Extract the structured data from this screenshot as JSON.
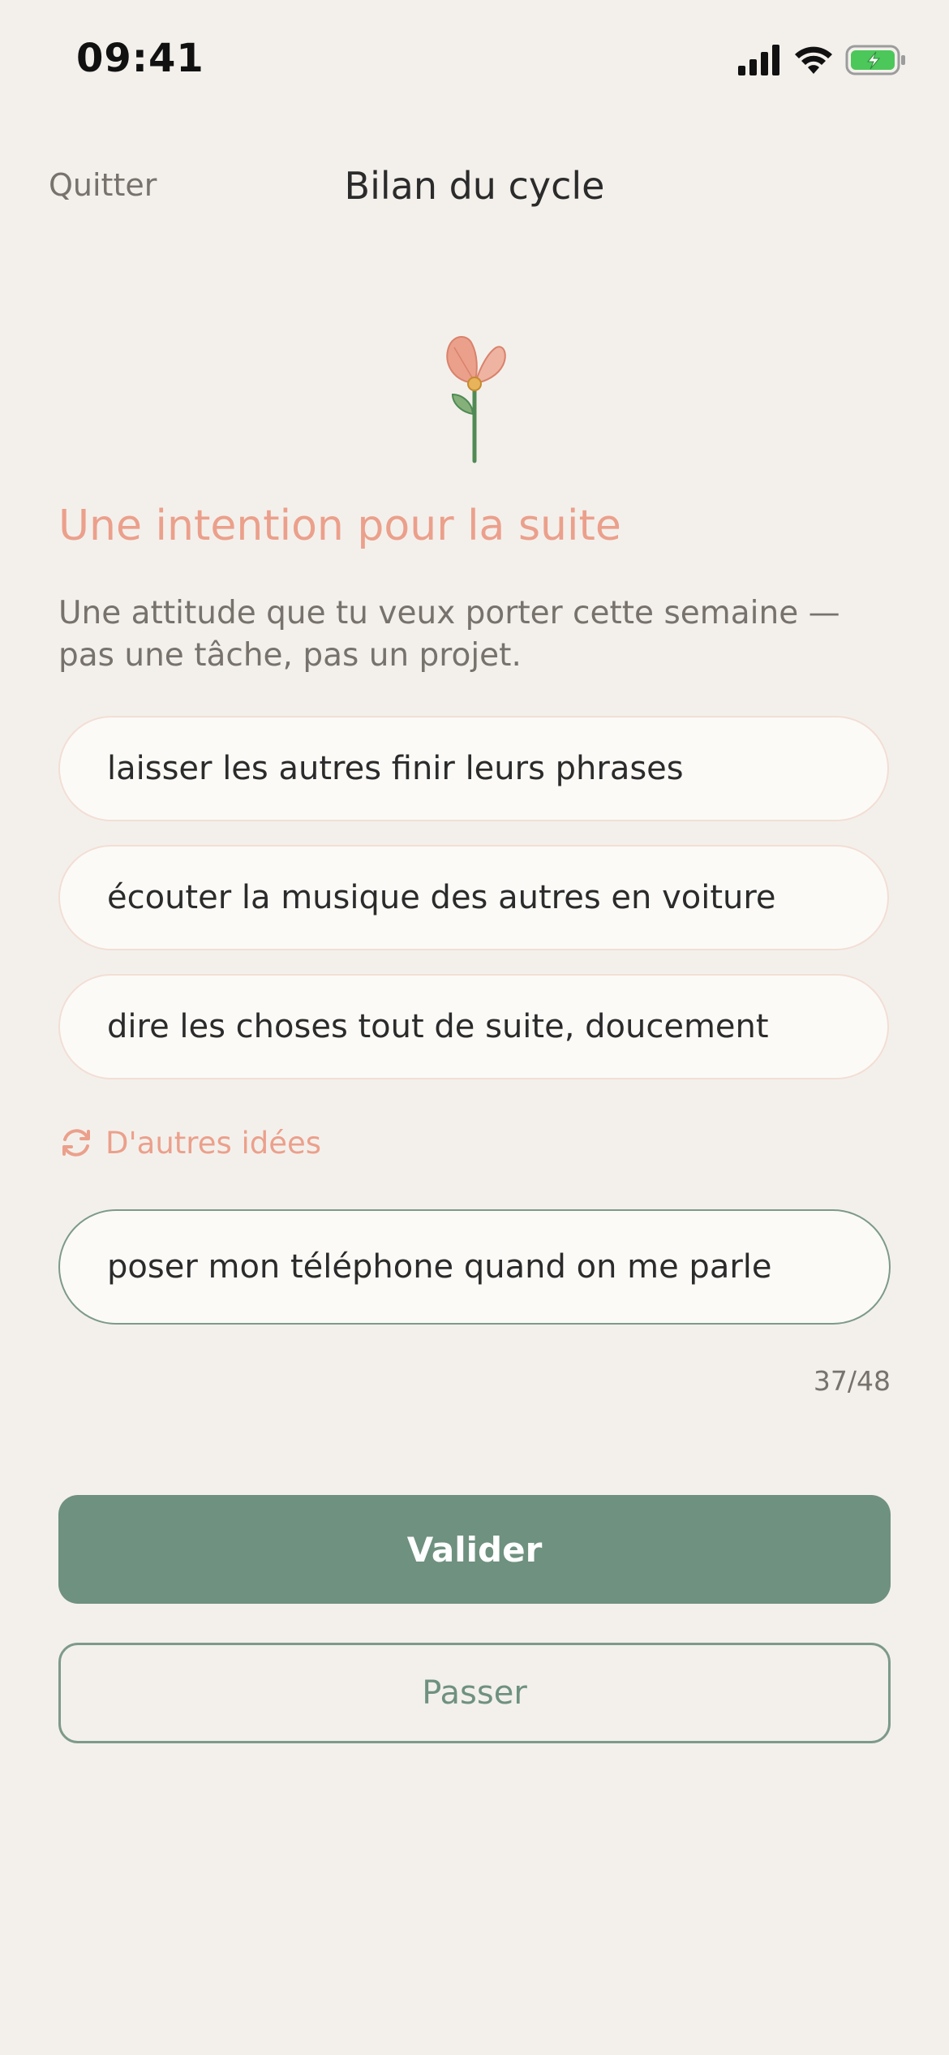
{
  "status_bar": {
    "time": "09:41"
  },
  "nav": {
    "quit_label": "Quitter",
    "title": "Bilan du cycle"
  },
  "content": {
    "heading": "Une intention pour la suite",
    "subheading": "Une attitude que tu veux porter cette semaine — pas une tâche, pas un projet.",
    "suggestions": [
      "laisser les autres finir leurs phrases",
      "écouter la musique des autres en voiture",
      "dire les choses tout de suite, doucement"
    ],
    "more_ideas_label": "D'autres idées",
    "input_value": "poser mon téléphone quand on me parle",
    "counter": "37/48"
  },
  "actions": {
    "validate_label": "Valider",
    "skip_label": "Passer"
  },
  "colors": {
    "background": "#f3f0ec",
    "accent_coral": "#eba08b",
    "accent_green": "#6f917f"
  }
}
